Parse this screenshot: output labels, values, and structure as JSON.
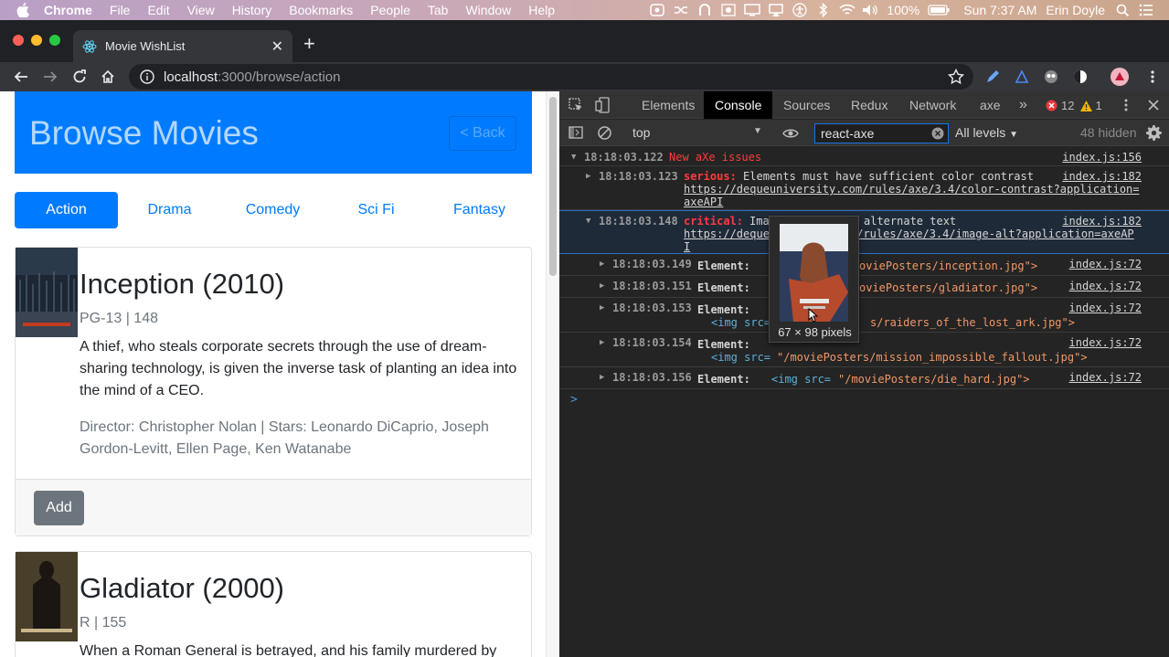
{
  "menubar": {
    "app": "Chrome",
    "items": [
      "File",
      "Edit",
      "View",
      "History",
      "Bookmarks",
      "People",
      "Tab",
      "Window",
      "Help"
    ],
    "battery": "100%",
    "clock": "Sun 7:37 AM",
    "user": "Erin Doyle"
  },
  "browser": {
    "tab_title": "Movie WishList",
    "url_host": "localhost",
    "url_path": ":3000/browse/action"
  },
  "page": {
    "heading": "Browse Movies",
    "back_label": "< Back",
    "categories": [
      {
        "label": "Action",
        "active": true
      },
      {
        "label": "Drama",
        "active": false
      },
      {
        "label": "Comedy",
        "active": false
      },
      {
        "label": "Sci Fi",
        "active": false
      },
      {
        "label": "Fantasy",
        "active": false
      }
    ],
    "movies": [
      {
        "title": "Inception (2010)",
        "meta": "PG-13 | 148",
        "description": "A thief, who steals corporate secrets through the use of dream-sharing technology, is given the inverse task of planting an idea into the mind of a CEO.",
        "credits": "Director: Christopher Nolan | Stars: Leonardo DiCaprio, Joseph Gordon-Levitt, Ellen Page, Ken Watanabe",
        "add_label": "Add"
      },
      {
        "title": "Gladiator (2000)",
        "meta": "R | 155",
        "description": "When a Roman General is betrayed, and his family murdered by"
      }
    ]
  },
  "devtools": {
    "tabs": [
      "Elements",
      "Console",
      "Sources",
      "Redux",
      "Network",
      "axe"
    ],
    "active_tab": "Console",
    "error_count": "12",
    "warning_count": "1",
    "context": "top",
    "filter_value": "react-axe",
    "levels": "All levels",
    "hidden": "48 hidden",
    "log": {
      "group": {
        "time": "18:18:03.122",
        "text": "New aXe issues",
        "src": "index.js:156"
      },
      "serious": {
        "time": "18:18:03.123",
        "level": "serious:",
        "text": "Elements must have sufficient color contrast",
        "url1": "https://dequeuniversity.com/rules/axe/3.4/color-contrast?application=",
        "url2": "axeAPI",
        "src": "index.js:182"
      },
      "critical": {
        "time": "18:18:03.148",
        "level": "critical:",
        "text_a": "Ima",
        "text_b": "alternate text",
        "url1a": "https://deque",
        "url1b": "m/rules/axe/3.4/image-alt?application=axeAP",
        "url2": "I",
        "src": "index.js:182"
      },
      "elements": [
        {
          "time": "18:18:03.149",
          "label": "Element:",
          "code": "oviePosters/inception.jpg\">",
          "src": "index.js:72"
        },
        {
          "time": "18:18:03.151",
          "label": "Element:",
          "code": "oviePosters/gladiator.jpg\">",
          "src": "index.js:72"
        },
        {
          "time": "18:18:03.153",
          "label": "Element:",
          "code_a": "<img src=",
          "code_b": "s/raiders_of_the_lost_ark.jpg\">",
          "src": "index.js:72"
        },
        {
          "time": "18:18:03.154",
          "label": "Element:",
          "code_a": "<img src=",
          "code_b": "\"/moviePosters/mission_impossible_fallout.jpg\">",
          "src": "index.js:72"
        },
        {
          "time": "18:18:03.156",
          "label": "Element:",
          "code_a": "<img src=",
          "code_b": "\"/moviePosters/die_hard.jpg\">",
          "src": "index.js:72"
        }
      ],
      "prompt": ">"
    },
    "tooltip_dims": "67 × 98 pixels"
  }
}
